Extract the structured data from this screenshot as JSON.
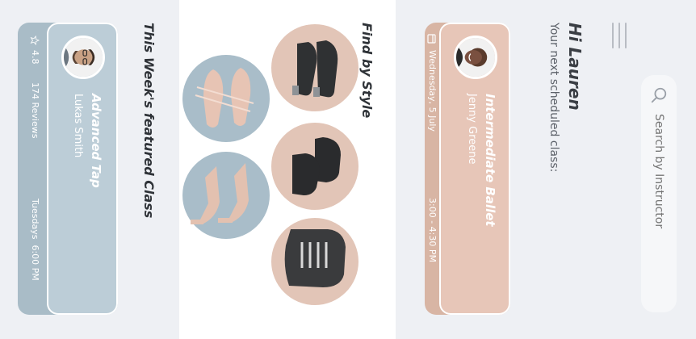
{
  "search": {
    "placeholder": "Search by Instructor"
  },
  "greeting": {
    "title": "Hi Lauren",
    "subtitle": "Your next scheduled class:"
  },
  "next_class": {
    "title": "Intermediate Ballet",
    "instructor": "Jenny Greene",
    "date": "Wednesday, 5 July",
    "time": "3:00 - 4:30 PM",
    "icon": "calendar-icon"
  },
  "find_by_style": {
    "title": "Find by Style",
    "items": [
      {
        "name": "tap",
        "icon": "tap-shoe-icon",
        "color": "#e2c5b7"
      },
      {
        "name": "jazz",
        "icon": "jazz-shoe-icon",
        "color": "#e2c5b7"
      },
      {
        "name": "hiphop",
        "icon": "sneaker-icon",
        "color": "#e2c5b7"
      },
      {
        "name": "ballet",
        "icon": "ballet-shoe-icon",
        "color": "#a9bdc9"
      },
      {
        "name": "heels",
        "icon": "heel-shoe-icon",
        "color": "#a9bdc9"
      }
    ]
  },
  "featured": {
    "section_title": "This Week's featured Class",
    "title": "Advanced Tap",
    "instructor": "Lukas Smith",
    "rating": "4.8",
    "reviews": "174 Reviews",
    "schedule": "Tuesdays  6:00 PM",
    "icon": "star-icon"
  },
  "colors": {
    "peach": "#e7c6b8",
    "peach_dark": "#d8b5a4",
    "blue": "#bccdd7",
    "blue_dark": "#a9bcc7"
  }
}
